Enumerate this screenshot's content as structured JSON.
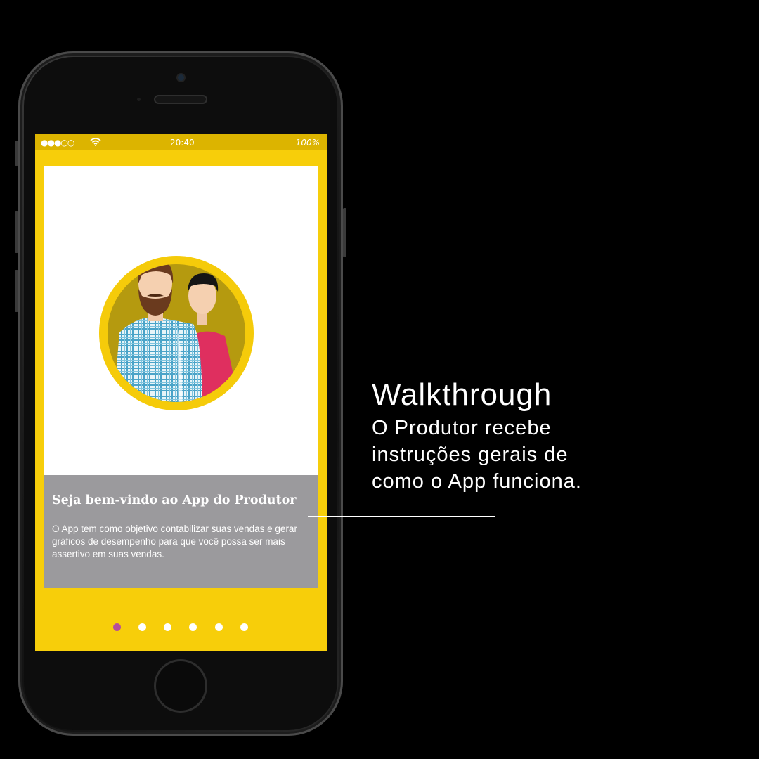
{
  "status_bar": {
    "signal": "●●●○○",
    "wifi_icon": "wifi-icon",
    "time": "20:40",
    "battery": "100%"
  },
  "walkthrough_card": {
    "illustration": "two-users-illustration",
    "title": "Seja bem-vindo ao App do Produtor",
    "body": "O App tem como objetivo contabilizar suas vendas e gerar gráficos de desempenho para que você possa ser mais assertivo em suas vendas."
  },
  "pager": {
    "total": 6,
    "active_index": 0
  },
  "callout": {
    "title": "Walkthrough",
    "line1": "O Produtor recebe",
    "line2": "instruções gerais de",
    "line3": "como o App funciona."
  },
  "colors": {
    "screen_bg": "#f7ce0a",
    "status_bar_bg": "#dcb400",
    "card_caption_bg": "#9b9a9d",
    "active_dot": "#b44d9c",
    "inactive_dot": "#ffffff",
    "page_bg": "#000000"
  }
}
